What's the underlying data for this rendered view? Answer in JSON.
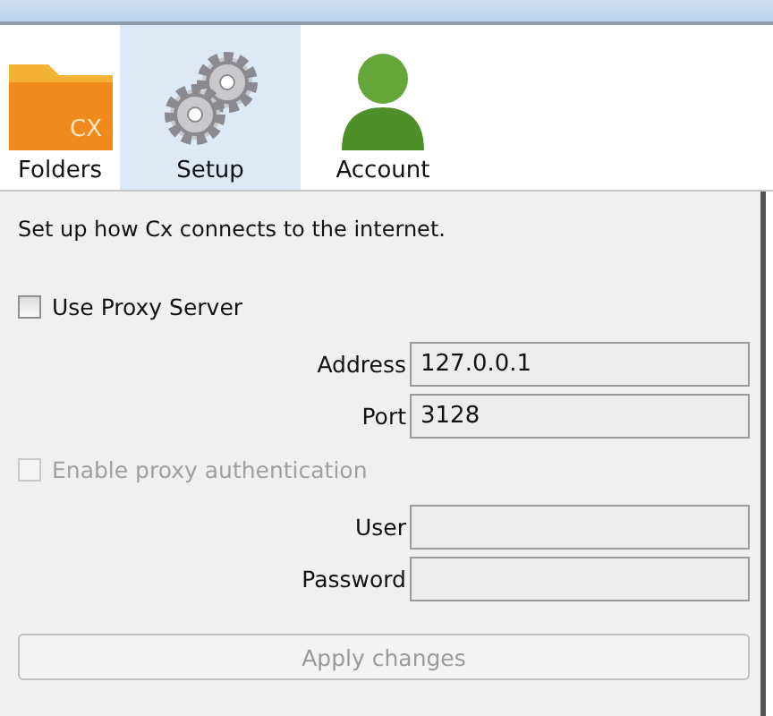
{
  "tabs": [
    {
      "label": "Folders",
      "kind": "folder",
      "badge": "CX",
      "selected": false
    },
    {
      "label": "Setup",
      "kind": "gears",
      "selected": true
    },
    {
      "label": "Account",
      "kind": "person",
      "selected": false
    }
  ],
  "intro": "Set up how Cx connects to the internet.",
  "use_proxy": {
    "label": "Use Proxy Server",
    "checked": false,
    "disabled": false
  },
  "proxy_fields": [
    {
      "label": "Address",
      "value": "127.0.0.1",
      "disabled": true
    },
    {
      "label": "Port",
      "value": "3128",
      "disabled": true
    }
  ],
  "auth": {
    "label": "Enable proxy authentication",
    "checked": false,
    "disabled": true
  },
  "auth_fields": [
    {
      "label": "User",
      "disabled": true
    },
    {
      "label": "Password",
      "disabled": true
    }
  ],
  "apply_button": {
    "label": "Apply changes",
    "disabled": true
  }
}
